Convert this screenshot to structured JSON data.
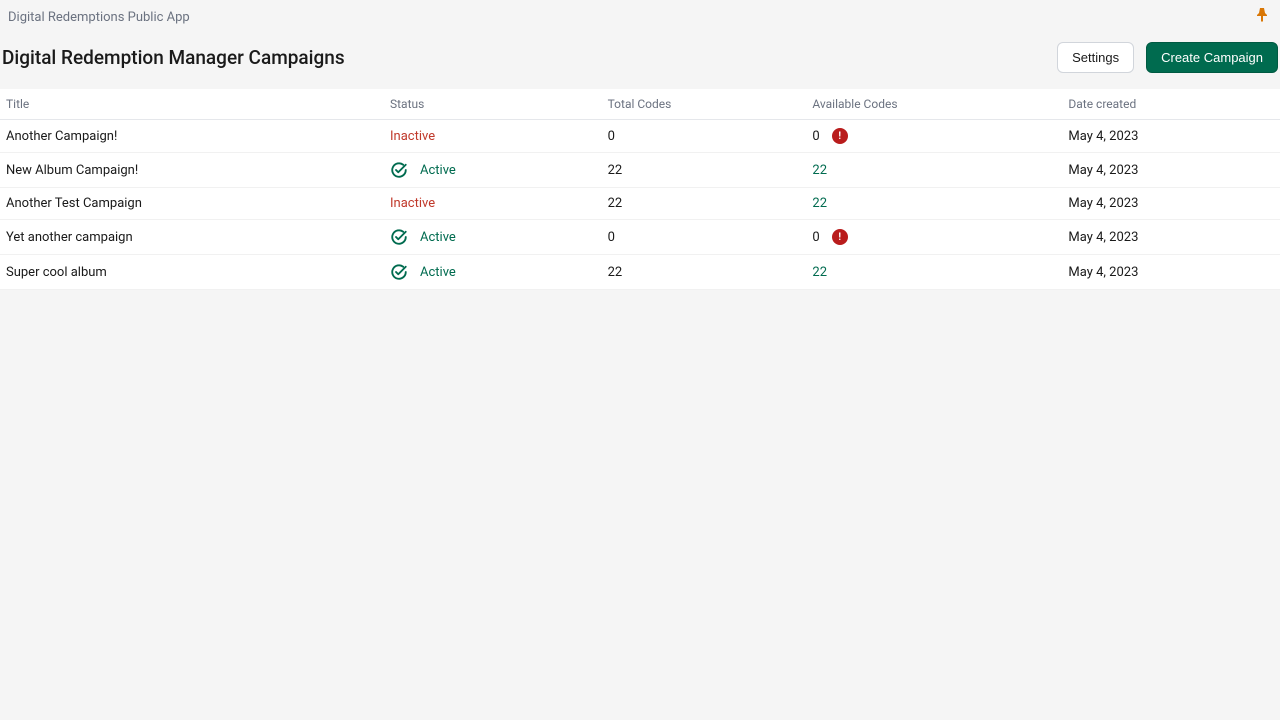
{
  "app": {
    "title": "Digital Redemptions Public App"
  },
  "header": {
    "page_title": "Digital Redemption Manager Campaigns",
    "settings_label": "Settings",
    "create_label": "Create Campaign"
  },
  "table": {
    "columns": {
      "title": "Title",
      "status": "Status",
      "total_codes": "Total Codes",
      "available_codes": "Available Codes",
      "date_created": "Date created"
    },
    "rows": [
      {
        "title": "Another Campaign!",
        "status": "Inactive",
        "status_type": "inactive",
        "total": "0",
        "available": "0",
        "avail_warn": true,
        "date": "May 4, 2023"
      },
      {
        "title": "New Album Campaign!",
        "status": "Active",
        "status_type": "active",
        "total": "22",
        "available": "22",
        "avail_warn": false,
        "date": "May 4, 2023"
      },
      {
        "title": "Another Test Campaign",
        "status": "Inactive",
        "status_type": "inactive",
        "total": "22",
        "available": "22",
        "avail_warn": false,
        "date": "May 4, 2023"
      },
      {
        "title": "Yet another campaign",
        "status": "Active",
        "status_type": "active",
        "total": "0",
        "available": "0",
        "avail_warn": true,
        "date": "May 4, 2023"
      },
      {
        "title": "Super cool album",
        "status": "Active",
        "status_type": "active",
        "total": "22",
        "available": "22",
        "avail_warn": false,
        "date": "May 4, 2023"
      }
    ]
  }
}
